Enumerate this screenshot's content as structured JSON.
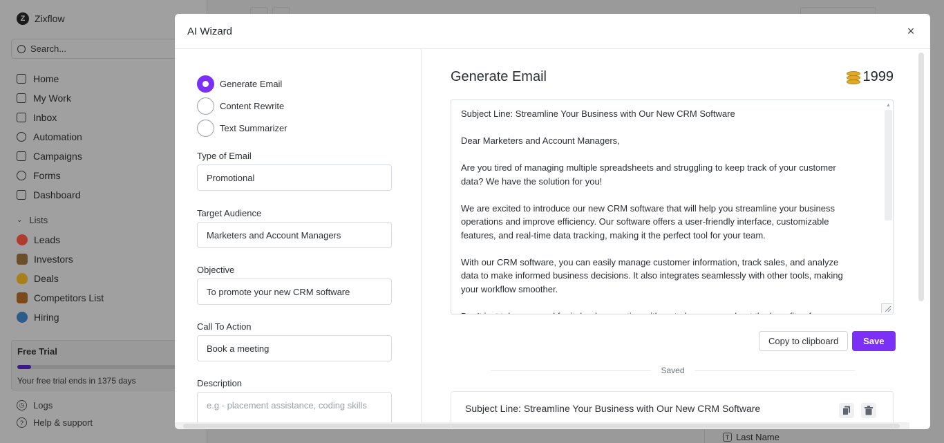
{
  "app": {
    "brand": "Zixflow",
    "search_placeholder": "Search...",
    "nav": [
      {
        "label": "Home",
        "icon": "home-icon"
      },
      {
        "label": "My Work",
        "icon": "checklist-icon"
      },
      {
        "label": "Inbox",
        "icon": "inbox-icon"
      },
      {
        "label": "Automation",
        "icon": "lightbulb-icon"
      },
      {
        "label": "Campaigns",
        "icon": "megaphone-icon"
      },
      {
        "label": "Forms",
        "icon": "chat-icon"
      },
      {
        "label": "Dashboard",
        "icon": "bar-chart-icon"
      }
    ],
    "lists_heading": "Lists",
    "lists": [
      {
        "label": "Leads",
        "icon": "target-icon",
        "color": "#c0392b"
      },
      {
        "label": "Investors",
        "icon": "abacus-icon",
        "color": "#6b4f2a"
      },
      {
        "label": "Deals",
        "icon": "money-bag-icon",
        "color": "#b8860b"
      },
      {
        "label": "Competitors List",
        "icon": "clapper-icon",
        "color": "#7a4a1d"
      },
      {
        "label": "Hiring",
        "icon": "magnifier-icon",
        "color": "#2d5b8a"
      }
    ],
    "trial": {
      "title": "Free Trial",
      "progress": 0.08,
      "text": "Your free trial ends in 1375 days"
    },
    "footer": {
      "logs": "Logs",
      "help": "Help & support"
    },
    "bg_column_label": "Last Name"
  },
  "modal": {
    "title": "AI Wizard",
    "modes": [
      {
        "label": "Generate Email",
        "selected": true
      },
      {
        "label": "Content Rewrite",
        "selected": false
      },
      {
        "label": "Text Summarizer",
        "selected": false
      }
    ],
    "fields": {
      "type_label": "Type of Email",
      "type_value": "Promotional",
      "audience_label": "Target Audience",
      "audience_value": "Marketers and Account Managers",
      "objective_label": "Objective",
      "objective_value": "To promote your new CRM software",
      "cta_label": "Call To Action",
      "cta_value": "Book a meeting",
      "description_label": "Description",
      "description_placeholder": "e.g - placement assistance, coding skills"
    },
    "output": {
      "heading": "Generate Email",
      "credits": "1999",
      "email_lines": [
        "Subject Line: Streamline Your Business with Our New CRM Software",
        "",
        "Dear Marketers and Account Managers,",
        "",
        "Are you tired of managing multiple spreadsheets and struggling to keep track of your customer",
        "data? We have the solution for you!",
        "",
        "We are excited to introduce our new CRM software that will help you streamline your business",
        "operations and improve efficiency. Our software offers a user-friendly interface, customizable",
        "features, and real-time data tracking, making it the perfect tool for your team.",
        "",
        "With our CRM software, you can easily manage customer information, track sales, and analyze",
        "data to make informed business decisions. It also integrates seamlessly with other tools, making",
        "your workflow smoother.",
        "",
        "Don't just take our word for it, book a meeting with us to learn more about the benefits of our"
      ],
      "copy_label": "Copy to clipboard",
      "save_label": "Save",
      "saved_label": "Saved",
      "saved_subject": "Subject Line: Streamline Your Business with Our New CRM Software"
    }
  },
  "colors": {
    "accent": "#7b2ff7"
  }
}
